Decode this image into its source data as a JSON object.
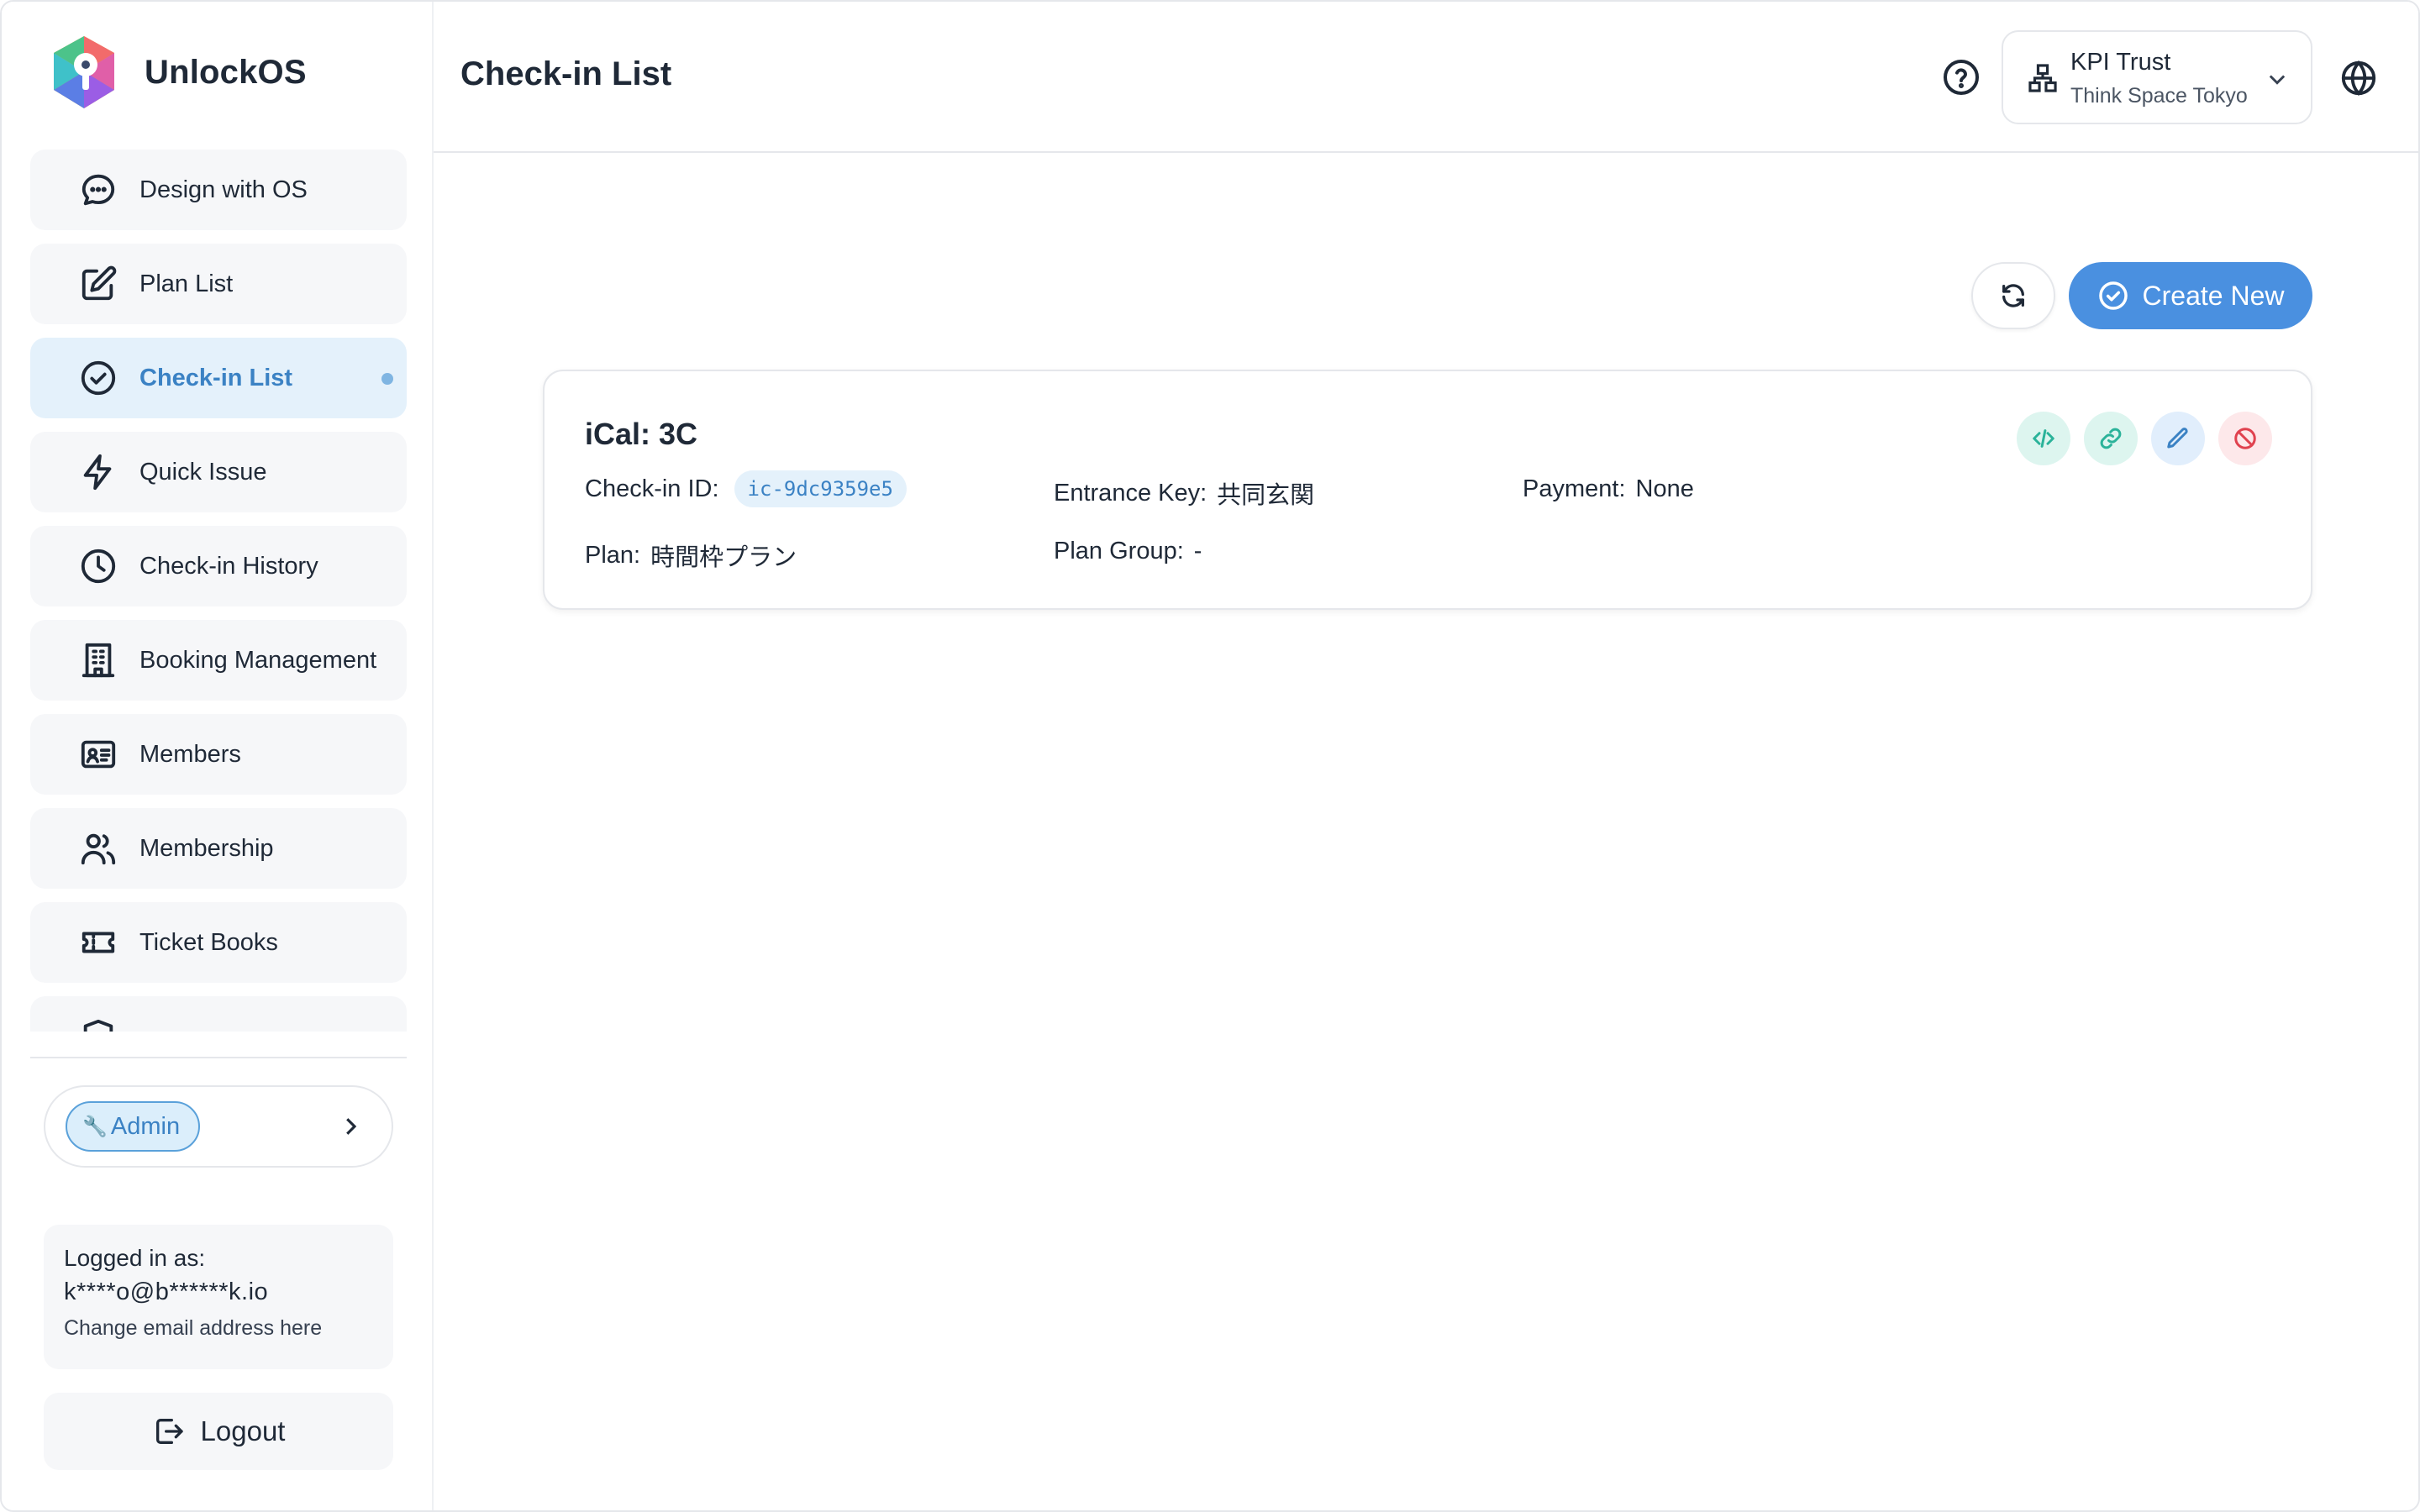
{
  "app": {
    "name": "UnlockOS"
  },
  "sidebar": {
    "items": [
      {
        "label": "Design with OS",
        "icon": "chat-bubble-icon"
      },
      {
        "label": "Plan List",
        "icon": "edit-square-icon"
      },
      {
        "label": "Check-in List",
        "icon": "check-circle-icon",
        "active": true
      },
      {
        "label": "Quick Issue",
        "icon": "lightning-icon"
      },
      {
        "label": "Check-in History",
        "icon": "clock-icon"
      },
      {
        "label": "Booking Management",
        "icon": "building-icon"
      },
      {
        "label": "Members",
        "icon": "id-card-icon"
      },
      {
        "label": "Membership",
        "icon": "users-icon"
      },
      {
        "label": "Ticket Books",
        "icon": "ticket-icon"
      }
    ],
    "admin_label": "Admin",
    "login": {
      "label": "Logged in as:",
      "email": "k****o@b******k.io",
      "change_link": "Change email address here"
    },
    "logout_label": "Logout"
  },
  "header": {
    "title": "Check-in List",
    "org": {
      "name": "KPI Trust",
      "location": "Think Space Tokyo"
    }
  },
  "toolbar": {
    "create_label": "Create New"
  },
  "cards": [
    {
      "title": "iCal: 3C",
      "checkin_id_label": "Check-in ID:",
      "checkin_id": "ic-9dc9359e5",
      "entrance_key_label": "Entrance Key:",
      "entrance_key": "共同玄関",
      "payment_label": "Payment:",
      "payment": "None",
      "plan_label": "Plan:",
      "plan": "時間枠プラン",
      "plan_group_label": "Plan Group:",
      "plan_group": "-"
    }
  ],
  "colors": {
    "accent": "#4a90e0",
    "active_bg": "#e4f1fb",
    "active_text": "#3b82c4",
    "success": "#2bb39a",
    "danger": "#e0424f"
  }
}
